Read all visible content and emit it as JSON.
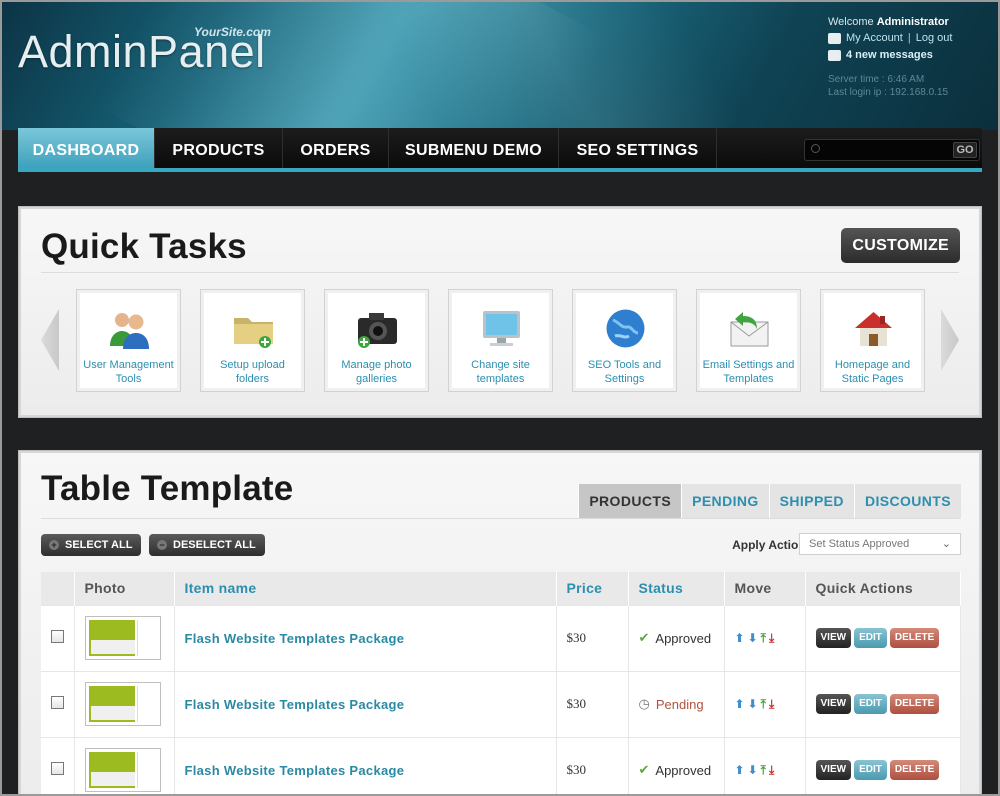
{
  "header": {
    "logo": "AdminPanel",
    "site": "YourSite.com",
    "welcome_prefix": "Welcome",
    "user": "Administrator",
    "my_account": "My Account",
    "separator": "|",
    "logout": "Log out",
    "messages": "4 new messages",
    "server_time": "Server time : 6:46 AM",
    "last_login": "Last login ip : 192.168.0.15"
  },
  "nav": {
    "items": [
      {
        "label": "DASHBOARD"
      },
      {
        "label": "PRODUCTS"
      },
      {
        "label": "ORDERS"
      },
      {
        "label": "SUBMENU DEMO"
      },
      {
        "label": "SEO SETTINGS"
      }
    ],
    "search_go": "GO"
  },
  "quick_tasks": {
    "title": "Quick Tasks",
    "customize": "CUSTOMIZE",
    "tasks": [
      {
        "label": "User Management Tools",
        "icon": "users-icon"
      },
      {
        "label": "Setup upload folders",
        "icon": "folder-icon"
      },
      {
        "label": "Manage photo galleries",
        "icon": "camera-icon"
      },
      {
        "label": "Change site templates",
        "icon": "monitor-icon"
      },
      {
        "label": "SEO Tools and Settings",
        "icon": "globe-icon"
      },
      {
        "label": "Email Settings and Templates",
        "icon": "envelope-icon"
      },
      {
        "label": "Homepage and Static Pages",
        "icon": "house-icon"
      }
    ]
  },
  "table": {
    "title": "Table Template",
    "tabs": [
      "PRODUCTS",
      "PENDING",
      "SHIPPED",
      "DISCOUNTS"
    ],
    "select_all": "SELECT ALL",
    "deselect_all": "DESELECT ALL",
    "apply_label": "Apply Action :",
    "apply_value": "Set Status Approved",
    "columns": [
      "Photo",
      "Item name",
      "Price",
      "Status",
      "Move",
      "Quick Actions"
    ],
    "rows": [
      {
        "name": "Flash Website Templates Package",
        "price": "$30",
        "status": "Approved"
      },
      {
        "name": "Flash Website Templates Package",
        "price": "$30",
        "status": "Pending"
      },
      {
        "name": "Flash Website Templates Package",
        "price": "$30",
        "status": "Approved"
      }
    ],
    "actions": {
      "view": "VIEW",
      "edit": "EDIT",
      "delete": "DELETE"
    }
  },
  "colors": {
    "accent": "#3aa7c2",
    "link": "#2b8fb0",
    "pending": "#b0533e"
  }
}
